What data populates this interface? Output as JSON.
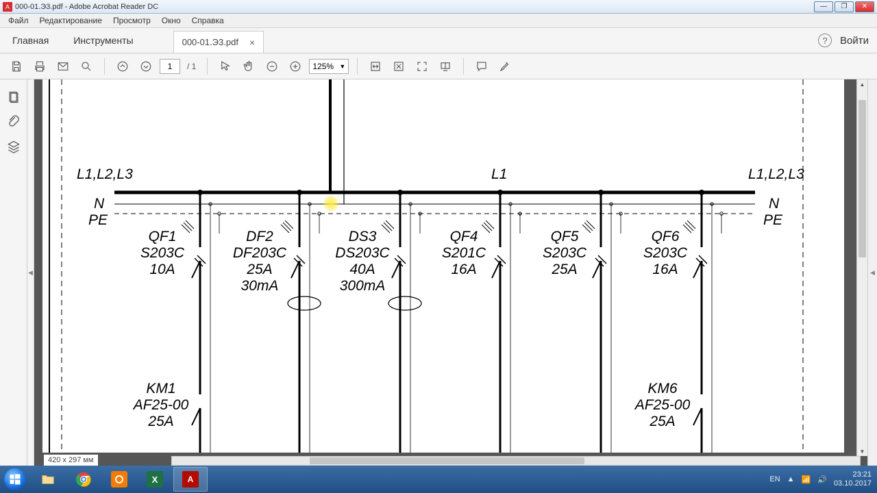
{
  "window": {
    "title": "000-01.Э3.pdf - Adobe Acrobat Reader DC"
  },
  "menu": {
    "file": "Файл",
    "edit": "Редактирование",
    "view": "Просмотр",
    "window": "Окно",
    "help": "Справка"
  },
  "tabs": {
    "home": "Главная",
    "tools": "Инструменты",
    "doc": "000-01.Э3.pdf",
    "signin": "Войти"
  },
  "toolbar": {
    "page_current": "1",
    "page_total": "/ 1",
    "zoom": "125%"
  },
  "status": {
    "dimensions": "420 x 297 мм"
  },
  "diagram": {
    "bus_left": "L1,L2,L3",
    "bus_mid": "L1",
    "bus_right": "L1,L2,L3",
    "n_left": "N",
    "pe_left": "PE",
    "n_right": "N",
    "pe_right": "PE",
    "breakers": [
      {
        "lines": "QF1\nS203C\n10A"
      },
      {
        "lines": "DF2\nDF203C\n25A\n30mA"
      },
      {
        "lines": "DS3\nDS203C\n40A\n300mA"
      },
      {
        "lines": "QF4\nS201C\n16A"
      },
      {
        "lines": "QF5\nS203C\n25A"
      },
      {
        "lines": "QF6\nS203C\n16A"
      }
    ],
    "contactors": {
      "km1": "KM1\nAF25-00\n25A",
      "km6": "KM6\nAF25-00\n25A"
    }
  },
  "tray": {
    "lang": "EN",
    "time": "23:21",
    "date": "03.10.2017"
  }
}
